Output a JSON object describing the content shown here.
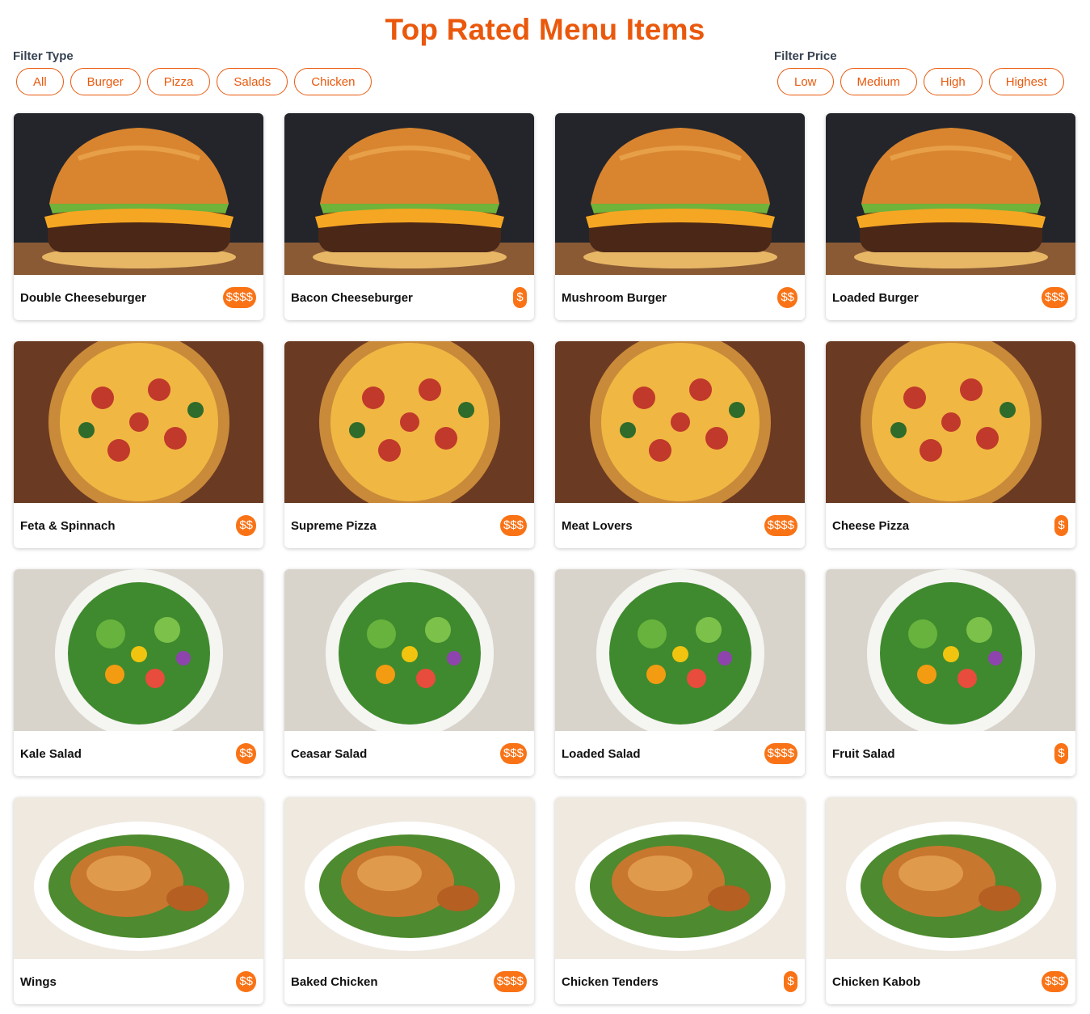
{
  "page_title": "Top Rated Menu Items",
  "filters": {
    "type": {
      "label": "Filter Type",
      "options": [
        "All",
        "Burger",
        "Pizza",
        "Salads",
        "Chicken"
      ]
    },
    "price": {
      "label": "Filter Price",
      "options": [
        "Low",
        "Medium",
        "High",
        "Highest"
      ]
    }
  },
  "colors": {
    "accent": "#ea580c",
    "badge": "#f97316"
  },
  "items": [
    {
      "name": "Double Cheeseburger",
      "price": "$$$$",
      "image": "burger-photo"
    },
    {
      "name": "Bacon Cheeseburger",
      "price": "$",
      "image": "burger-photo"
    },
    {
      "name": "Mushroom Burger",
      "price": "$$",
      "image": "burger-photo"
    },
    {
      "name": "Loaded Burger",
      "price": "$$$",
      "image": "burger-photo"
    },
    {
      "name": "Feta & Spinnach",
      "price": "$$",
      "image": "pizza-photo"
    },
    {
      "name": "Supreme Pizza",
      "price": "$$$",
      "image": "pizza-photo"
    },
    {
      "name": "Meat Lovers",
      "price": "$$$$",
      "image": "pizza-photo"
    },
    {
      "name": "Cheese Pizza",
      "price": "$",
      "image": "pizza-photo"
    },
    {
      "name": "Kale Salad",
      "price": "$$",
      "image": "salad-photo"
    },
    {
      "name": "Ceasar Salad",
      "price": "$$$",
      "image": "salad-photo"
    },
    {
      "name": "Loaded Salad",
      "price": "$$$$",
      "image": "salad-photo"
    },
    {
      "name": "Fruit Salad",
      "price": "$",
      "image": "salad-photo"
    },
    {
      "name": "Wings",
      "price": "$$",
      "image": "chicken-photo"
    },
    {
      "name": "Baked Chicken",
      "price": "$$$$",
      "image": "chicken-photo"
    },
    {
      "name": "Chicken Tenders",
      "price": "$",
      "image": "chicken-photo"
    },
    {
      "name": "Chicken Kabob",
      "price": "$$$",
      "image": "chicken-photo"
    }
  ]
}
